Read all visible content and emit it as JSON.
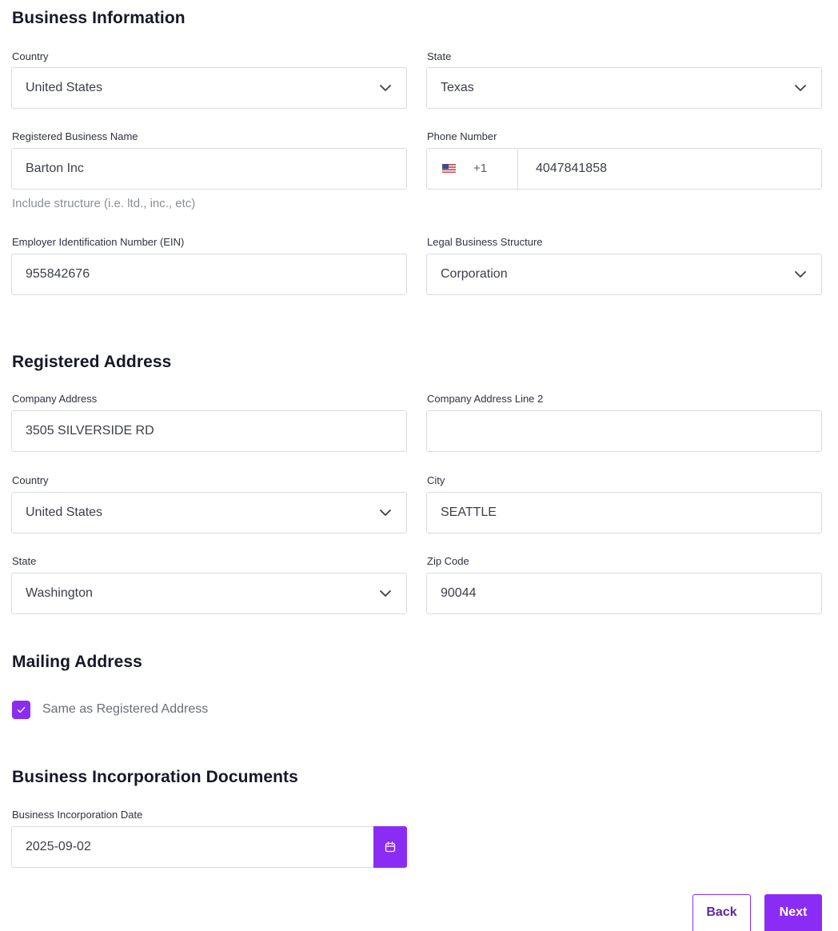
{
  "business_information": {
    "title": "Business Information",
    "country": {
      "label": "Country",
      "value": "United States"
    },
    "state": {
      "label": "State",
      "value": "Texas"
    },
    "business_name": {
      "label": "Registered Business Name",
      "value": "Barton Inc",
      "helper": "Include structure (i.e. ltd., inc., etc)"
    },
    "phone": {
      "label": "Phone Number",
      "dial_code": "+1",
      "flag_icon": "us-flag-icon",
      "value": "4047841858"
    },
    "ein": {
      "label": "Employer Identification Number (EIN)",
      "value": "955842676"
    },
    "legal_structure": {
      "label": "Legal Business Structure",
      "value": "Corporation"
    }
  },
  "registered_address": {
    "title": "Registered Address",
    "address1": {
      "label": "Company Address",
      "value": "3505 SILVERSIDE RD"
    },
    "address2": {
      "label": "Company Address Line 2",
      "value": ""
    },
    "country": {
      "label": "Country",
      "value": "United States"
    },
    "city": {
      "label": "City",
      "value": "SEATTLE"
    },
    "state": {
      "label": "State",
      "value": "Washington"
    },
    "zip": {
      "label": "Zip Code",
      "value": "90044"
    }
  },
  "mailing_address": {
    "title": "Mailing Address",
    "same_as_registered": {
      "label": "Same as Registered Address",
      "checked": true
    }
  },
  "incorporation_documents": {
    "title": "Business Incorporation Documents",
    "date": {
      "label": "Business Incorporation Date",
      "value": "2025-09-02",
      "icon": "calendar-icon"
    }
  },
  "actions": {
    "back_label": "Back",
    "next_label": "Next"
  },
  "colors": {
    "accent": "#8b2cf5",
    "border": "#d9dbe2",
    "text": "#1f2230",
    "helper_text": "#8b8e98"
  }
}
